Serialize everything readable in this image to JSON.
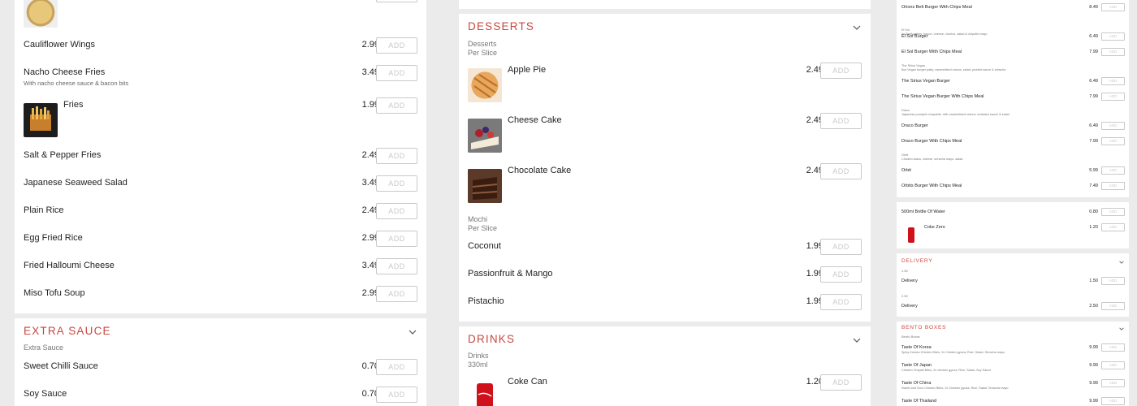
{
  "col1": {
    "top_items": [
      {
        "name": "Cauliflower Wings",
        "desc": "",
        "price": "2.99"
      },
      {
        "name": "Nacho Cheese Fries",
        "desc": "With nacho cheese sauce & bacon bits",
        "price": "3.49"
      },
      {
        "name": "Fries",
        "desc": "",
        "price": "1.99"
      },
      {
        "name": "Salt & Pepper Fries",
        "desc": "",
        "price": "2.49"
      },
      {
        "name": "Japanese Seaweed Salad",
        "desc": "",
        "price": "3.49"
      },
      {
        "name": "Plain Rice",
        "desc": "",
        "price": "2.49"
      },
      {
        "name": "Egg Fried Rice",
        "desc": "",
        "price": "2.99"
      },
      {
        "name": "Fried Halloumi Cheese",
        "desc": "",
        "price": "3.49"
      },
      {
        "name": "Miso Tofu Soup",
        "desc": "",
        "price": "2.99"
      }
    ],
    "extra_sauce": {
      "title": "EXTRA SAUCE",
      "subhead": "Extra Sauce",
      "items": [
        {
          "name": "Sweet Chilli Sauce",
          "price": "0.70"
        },
        {
          "name": "Soy Sauce",
          "price": "0.70"
        }
      ]
    }
  },
  "add_label": "ADD",
  "col2": {
    "desserts": {
      "title": "DESSERTS",
      "group1_title": "Desserts",
      "group1_sub": "Per Slice",
      "group1_items": [
        {
          "name": "Apple Pie",
          "price": "2.49"
        },
        {
          "name": "Cheese Cake",
          "price": "2.49"
        },
        {
          "name": "Chocolate Cake",
          "price": "2.49"
        }
      ],
      "group2_title": "Mochi",
      "group2_sub": "Per Slice",
      "group2_items": [
        {
          "name": "Coconut",
          "price": "1.99"
        },
        {
          "name": "Passionfruit & Mango",
          "price": "1.99"
        },
        {
          "name": "Pistachio",
          "price": "1.99"
        }
      ]
    },
    "drinks": {
      "title": "DRINKS",
      "group_title": "Drinks",
      "group_sub": "330ml",
      "items": [
        {
          "name": "Coke Can",
          "price": "1.20"
        }
      ]
    }
  },
  "col3": {
    "burgers": [
      {
        "name": "Orions Belt Burger With Chips Meal",
        "desc": "",
        "price": "8.49"
      },
      {
        "name": "El Sol Burger",
        "desc": "El Sol\n2x Beef patties, bacon, cheese, chorizo, salad & chipotle mayo",
        "price": "6.49"
      },
      {
        "name": "El Sol Burger With Chips Meal",
        "desc": "",
        "price": "7.99"
      },
      {
        "name": "The Sirius Vegan Burger",
        "desc": "The Sirius Vegan\n8oz Vegan burger patty, caramelised onions, salad, pickled sauce & sriracha",
        "price": "6.49"
      },
      {
        "name": "The Sirius Vegan Burger With Chips Meal",
        "desc": "",
        "price": "7.99"
      },
      {
        "name": "Draco Burger",
        "desc": "Draco\nJapanese pumpkin croquette, with caramelised onions, tonkatsu sauce & salad",
        "price": "6.49"
      },
      {
        "name": "Draco Burger With Chips Meal",
        "desc": "",
        "price": "7.99"
      },
      {
        "name": "Orbit",
        "desc": "Orbit\nChicken katsu, cheese, sriracha mayo, salad",
        "price": "5.99"
      },
      {
        "name": "Orbits Burger With Chips Meal",
        "desc": "",
        "price": "7.49"
      }
    ],
    "water": {
      "name": "500ml Bottle Of Water",
      "price": "0.80"
    },
    "coke_zero": {
      "name": "Coke Zero",
      "price": "1.20"
    },
    "delivery": {
      "title": "DELIVERY",
      "items": [
        {
          "sub": "1.50",
          "name": "Delivery",
          "price": "1.50"
        },
        {
          "sub": "2.50",
          "name": "Delivery",
          "price": "2.50"
        }
      ]
    },
    "bento": {
      "title": "BENTO BOXES",
      "subhead": "Bento Boxes",
      "items": [
        {
          "name": "Taste Of Korea",
          "desc": "Spicy Korean Chicken Bites, 2x Chicken gyoza, Rice, Salad, Sriracha mayo",
          "price": "9.99"
        },
        {
          "name": "Taste Of Japan",
          "desc": "Chicken Teriyaki Bites, 2x chicken gyoza, Rice, Salad, Soy Sauce",
          "price": "9.99"
        },
        {
          "name": "Taste Of China",
          "desc": "Sweet and Sour Chicken Bites, 2x Chicken gyoza, Rice, Salad, Sriracha mayo",
          "price": "9.99"
        },
        {
          "name": "Taste Of Thailand",
          "desc": "",
          "price": "9.99"
        }
      ]
    }
  }
}
